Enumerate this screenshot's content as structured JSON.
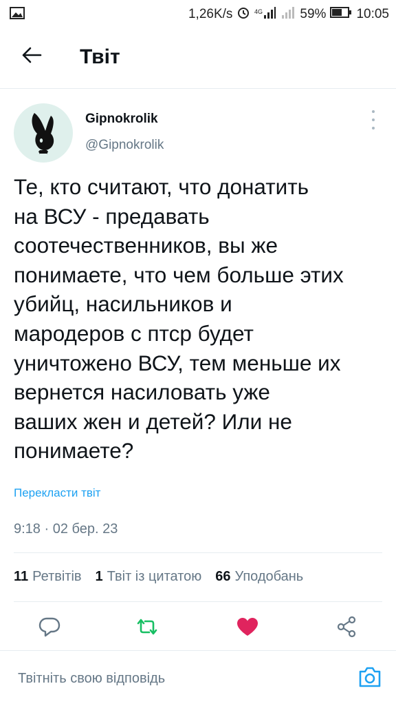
{
  "status_bar": {
    "speed": "1,26K/s",
    "battery": "59%",
    "time": "10:05",
    "icons": [
      "image-icon",
      "alarm-icon",
      "signal-4g-icon",
      "signal-icon",
      "battery-icon"
    ]
  },
  "header": {
    "title": "Твіт",
    "back_icon": "arrow-left-icon"
  },
  "tweet": {
    "author_name": "Gipnokrolik",
    "author_handle": "@Gipnokrolik",
    "text": "Те, кто считают, что донатить\nна ВСУ - предавать\nсоотечественников, вы же\nпонимаете, что чем больше этих\nубийц, насильников и\nмародеров с птср будет\nуничтожено ВСУ, тем меньше их\nвернется насиловать уже\nваших жен и детей? Или не\nпонимаете?",
    "translate_label": "Перекласти твіт",
    "timestamp": "9:18 · 02 бер. 23"
  },
  "stats": {
    "retweets_count": "11",
    "retweets_label": "Ретвітів",
    "quotes_count": "1",
    "quotes_label": "Твіт із цитатою",
    "likes_count": "66",
    "likes_label": "Уподобань"
  },
  "actions": {
    "reply_icon": "reply-icon",
    "retweet_icon": "retweet-icon",
    "like_icon": "heart-icon",
    "share_icon": "share-icon",
    "colors": {
      "retweet": "#17bf63",
      "like": "#e0245e",
      "muted": "#657786"
    }
  },
  "reply_bar": {
    "placeholder": "Твітніть свою відповідь",
    "camera_icon": "camera-icon",
    "accent": "#1da1f2"
  }
}
